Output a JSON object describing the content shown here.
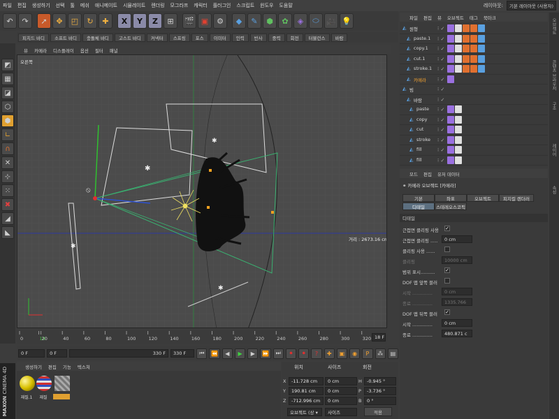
{
  "menubar": [
    "파일",
    "편집",
    "생성하기",
    "선택",
    "툴",
    "메쉬",
    "애니메이트",
    "시뮬레이트",
    "렌더링",
    "모그라프",
    "캐릭터",
    "플러그인",
    "스크립트",
    "윈도우",
    "도움말"
  ],
  "right_header": {
    "label": "레이아웃:",
    "layout": "기본 레이아웃 (사용자)"
  },
  "toolbar_icons": [
    "undo-icon",
    "redo-icon",
    "select-arrow-icon",
    "move-icon",
    "scale-icon",
    "rotate-icon",
    "add-icon",
    "x-axis-icon",
    "y-axis-icon",
    "z-axis-icon",
    "coord-icon",
    "render-view-icon",
    "render-icon",
    "render-settings-icon",
    "cube-icon",
    "pen-icon",
    "subdivision-icon",
    "cloner-icon",
    "deformer-icon",
    "floor-icon",
    "camera-icon",
    "light-icon"
  ],
  "axis_buttons": {
    "x": "X",
    "y": "Y",
    "z": "Z"
  },
  "subbar": [
    "피치드 바디",
    "소프트 바디",
    "충돌체 바디",
    "고스트 바디",
    "커넥터",
    "스프링",
    "포스",
    "이미터",
    "인력",
    "반사",
    "중력",
    "회전",
    "터뷸런스",
    "바람"
  ],
  "viewport": {
    "menu": [
      "뷰",
      "카메라",
      "디스플레이",
      "옵션",
      "필터",
      "패널"
    ],
    "label": "오른쪽",
    "distance": "거리 : 2673.16 cm"
  },
  "timeline": {
    "ticks": [
      "0",
      "18",
      "20",
      "40",
      "60",
      "80",
      "100",
      "120",
      "140",
      "160",
      "180",
      "200",
      "220",
      "240",
      "260",
      "280",
      "300",
      "320"
    ],
    "frame": "18 F"
  },
  "transport": {
    "start": "0 F",
    "current": "0 F",
    "end_inner": "330 F",
    "end": "330 F"
  },
  "materials": {
    "menu": [
      "생성하기",
      "편집",
      "기능",
      "텍스쳐"
    ],
    "items": [
      "재질.1",
      "재질",
      ""
    ]
  },
  "coords": {
    "headers": [
      "위치",
      "사이즈",
      "회전"
    ],
    "rows": [
      {
        "axis": "X",
        "pos": "-11.728 cm",
        "size": "0 cm",
        "rot_axis": "H",
        "rot": "-0.945 °"
      },
      {
        "axis": "Y",
        "pos": "190.81 cm",
        "size": "0 cm",
        "rot_axis": "P",
        "rot": "-3.736 °"
      },
      {
        "axis": "Z",
        "pos": "-712.996 cm",
        "size": "0 cm",
        "rot_axis": "B",
        "rot": "0 °"
      }
    ],
    "mode": "오브젝트 (상 ▾",
    "size_mode": "사이즈",
    "apply": "적용"
  },
  "objmgr": {
    "menu": [
      "파일",
      "편집",
      "뷰",
      "오브젝트",
      "태그",
      "북마크"
    ],
    "rows": [
      {
        "name": "원형",
        "indent": 4,
        "color": "#d8d8d8"
      },
      {
        "name": "paste.1",
        "indent": 10,
        "color": "#d8d8d8"
      },
      {
        "name": "copy.1",
        "indent": 10,
        "color": "#d8d8d8"
      },
      {
        "name": "cut.1",
        "indent": 10,
        "color": "#d8d8d8"
      },
      {
        "name": "stroke.1",
        "indent": 10,
        "color": "#d8d8d8"
      },
      {
        "name": "카메라",
        "indent": 10,
        "color": "#f0a030"
      },
      {
        "name": "빔",
        "indent": 4,
        "color": "#d8d8d8"
      },
      {
        "name": "바람",
        "indent": 10,
        "color": "#d8d8d8"
      },
      {
        "name": "paste",
        "indent": 14,
        "color": "#d8d8d8"
      },
      {
        "name": "copy",
        "indent": 14,
        "color": "#d8d8d8"
      },
      {
        "name": "cut",
        "indent": 14,
        "color": "#d8d8d8"
      },
      {
        "name": "stroke",
        "indent": 14,
        "color": "#d8d8d8"
      },
      {
        "name": "fill",
        "indent": 14,
        "color": "#d8d8d8"
      },
      {
        "name": "fill",
        "indent": 14,
        "color": "#d8d8d8"
      }
    ]
  },
  "attrmgr": {
    "menu": [
      "모드",
      "편집",
      "유저 데이터"
    ],
    "title": "카메라 오브젝트 [카메라]",
    "tabs": [
      "기본",
      "좌표",
      "오브젝트",
      "피지컬 렌더러",
      "디테일",
      "스테레오스코픽"
    ],
    "section": "디테일",
    "rows": [
      {
        "label": "근접면 클리핑 사용",
        "check": "✓",
        "value": ""
      },
      {
        "label": "근접면 클리핑 .....",
        "check": "",
        "value": "0 cm"
      },
      {
        "label": "클리핑 사용 ......",
        "check": "",
        "value": ""
      },
      {
        "label": "클리핑",
        "check": "",
        "value": "10000 cm"
      },
      {
        "label": "범위 표시..........",
        "check": "✓",
        "value": ""
      },
      {
        "label": "DOF 맵 앞쪽 블러",
        "check": "",
        "value": ""
      },
      {
        "label": "시작 ..............",
        "check": "",
        "value": "0 cm"
      },
      {
        "label": "종료 ..............",
        "check": "",
        "value": "1335.766"
      },
      {
        "label": "DOF 맵 뒤쪽 블러",
        "check": "✓",
        "value": ""
      },
      {
        "label": "시작 ..............",
        "check": "",
        "value": "0 cm"
      },
      {
        "label": "종료 ..............",
        "check": "",
        "value": "480.871 c"
      }
    ]
  },
  "brand": {
    "line1": "MAXON",
    "line2": "CINEMA 4D"
  },
  "rstrip": [
    "오브젝트",
    "콘텐츠 브라우저",
    "구조",
    "레이어",
    "속성"
  ]
}
